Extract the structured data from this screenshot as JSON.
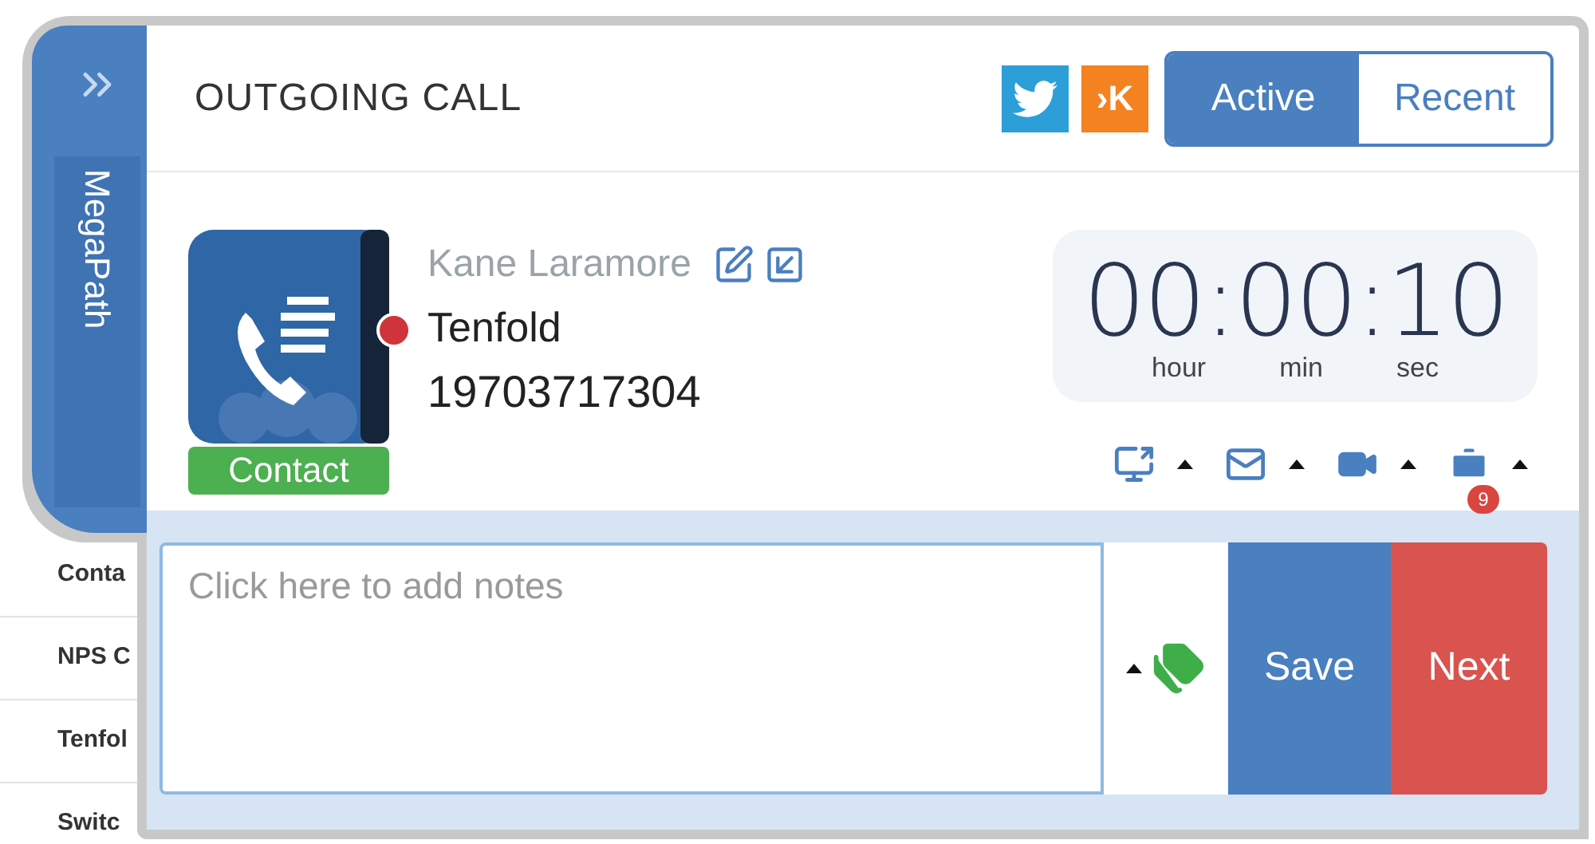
{
  "background_list": [
    "Conta",
    "NPS C",
    "Tenfol",
    "Switc"
  ],
  "sidebar": {
    "brand": "MegaPath"
  },
  "header": {
    "title": "OUTGOING CALL",
    "klout_logo": "›K",
    "tabs": [
      {
        "label": "Active",
        "selected": true
      },
      {
        "label": "Recent",
        "selected": false
      }
    ]
  },
  "contact": {
    "name": "Kane Laramore",
    "company": "Tenfold",
    "phone": "19703717304",
    "badge": "Contact"
  },
  "timer": {
    "value": "00:00:10",
    "labels": [
      "hour",
      "min",
      "sec"
    ]
  },
  "actions": [
    {
      "kind": "screen"
    },
    {
      "kind": "mail"
    },
    {
      "kind": "video"
    },
    {
      "kind": "briefcase",
      "badge": "9"
    }
  ],
  "notes": {
    "placeholder": "Click here to add notes"
  },
  "buttons": [
    {
      "label": "Save",
      "kind": "save"
    },
    {
      "label": "Next",
      "kind": "next"
    }
  ]
}
